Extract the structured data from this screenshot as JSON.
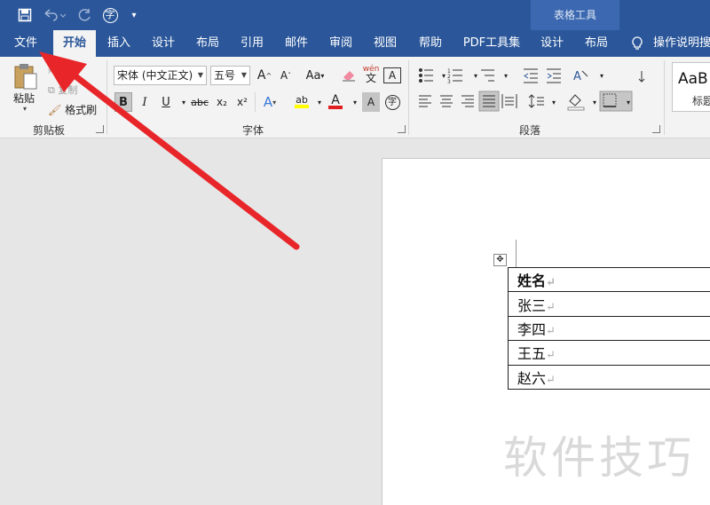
{
  "context_tab_group": "表格工具",
  "qat": {
    "save_icon": "save-icon",
    "undo_icon": "undo-icon",
    "redo_icon": "redo-icon",
    "special_icon": "字",
    "customize_icon": "customize-icon"
  },
  "tabs": [
    {
      "label": "文件"
    },
    {
      "label": "开始"
    },
    {
      "label": "插入"
    },
    {
      "label": "设计"
    },
    {
      "label": "布局"
    },
    {
      "label": "引用"
    },
    {
      "label": "邮件"
    },
    {
      "label": "审阅"
    },
    {
      "label": "视图"
    },
    {
      "label": "帮助"
    },
    {
      "label": "PDF工具集"
    },
    {
      "label": "设计"
    },
    {
      "label": "布局"
    }
  ],
  "tell_me": "操作说明搜索",
  "clipboard": {
    "paste": "粘贴",
    "cut": "剪切",
    "copy": "复制",
    "format_painter": "格式刷",
    "group": "剪贴板"
  },
  "font": {
    "name": "宋体 (中文正文)",
    "size": "五号",
    "grow": "A",
    "shrink": "A",
    "case": "Aa",
    "wen": "wén",
    "border_char": "A",
    "bold": "B",
    "italic": "I",
    "underline": "U",
    "strike": "abc",
    "sub": "x₂",
    "sup": "x²",
    "effects": "A",
    "highlight": "ab",
    "color": "A",
    "shade": "A",
    "enclose": "字",
    "group": "字体"
  },
  "paragraph": {
    "group": "段落"
  },
  "styles": {
    "sample": "AaB",
    "label": "标题"
  },
  "table": {
    "rows": [
      {
        "text": "姓名"
      },
      {
        "text": "张三"
      },
      {
        "text": "李四"
      },
      {
        "text": "王五"
      },
      {
        "text": "赵六"
      }
    ],
    "para_mark": "↵"
  },
  "watermark": "软件技巧",
  "colors": {
    "ribbon_blue": "#2b579a",
    "arrow_red": "#e8262a"
  }
}
